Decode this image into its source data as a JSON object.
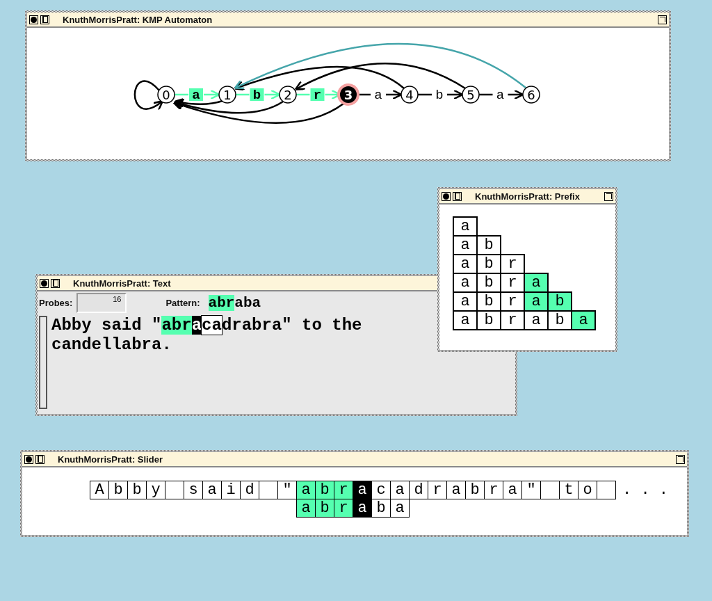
{
  "automaton_window": {
    "title": "KnuthMorrisPratt: KMP Automaton",
    "states": [
      {
        "label": "0",
        "kind": "plain"
      },
      {
        "label": "1",
        "kind": "plain"
      },
      {
        "label": "2",
        "kind": "plain"
      },
      {
        "label": "3",
        "kind": "current"
      },
      {
        "label": "4",
        "kind": "plain"
      },
      {
        "label": "5",
        "kind": "plain"
      },
      {
        "label": "6",
        "kind": "plain"
      }
    ],
    "failure_links": [
      {
        "highlighted": false
      },
      {
        "highlighted": false
      },
      {
        "highlighted": false
      },
      {
        "highlighted": false
      },
      {
        "highlighted": false
      },
      {
        "highlighted": true
      }
    ],
    "transitions": [
      {
        "label": "a",
        "highlighted": true
      },
      {
        "label": "b",
        "highlighted": true
      },
      {
        "label": "r",
        "highlighted": true
      },
      {
        "label": "a",
        "highlighted": false
      },
      {
        "label": "b",
        "highlighted": false
      },
      {
        "label": "a",
        "highlighted": false
      }
    ]
  },
  "text_window": {
    "title": "KnuthMorrisPratt: Text",
    "probes_label": "Probes:",
    "probes_value": "16",
    "pattern_label": "Pattern:",
    "pattern": [
      {
        "text": "abr",
        "kind": "match"
      },
      {
        "text": "aba",
        "kind": "plain"
      }
    ],
    "text": [
      {
        "text": "Abby said \"",
        "kind": "plain"
      },
      {
        "text": "abr",
        "kind": "match"
      },
      {
        "text": "a",
        "kind": "mismatch"
      },
      {
        "text": "ca",
        "kind": "window"
      },
      {
        "text": "drabra\" to the candellabra.",
        "kind": "plain"
      }
    ]
  },
  "prefix_window": {
    "title": "KnuthMorrisPratt: Prefix",
    "rows": [
      [
        {
          "char": "a",
          "highlighted": false
        }
      ],
      [
        {
          "char": "a",
          "highlighted": false
        },
        {
          "char": "b",
          "highlighted": false
        }
      ],
      [
        {
          "char": "a",
          "highlighted": false
        },
        {
          "char": "b",
          "highlighted": false
        },
        {
          "char": "r",
          "highlighted": false
        }
      ],
      [
        {
          "char": "a",
          "highlighted": false
        },
        {
          "char": "b",
          "highlighted": false
        },
        {
          "char": "r",
          "highlighted": false
        },
        {
          "char": "a",
          "highlighted": true
        }
      ],
      [
        {
          "char": "a",
          "highlighted": false
        },
        {
          "char": "b",
          "highlighted": false
        },
        {
          "char": "r",
          "highlighted": false
        },
        {
          "char": "a",
          "highlighted": true
        },
        {
          "char": "b",
          "highlighted": true
        }
      ],
      [
        {
          "char": "a",
          "highlighted": false
        },
        {
          "char": "b",
          "highlighted": false
        },
        {
          "char": "r",
          "highlighted": false
        },
        {
          "char": "a",
          "highlighted": false
        },
        {
          "char": "b",
          "highlighted": false
        },
        {
          "char": "a",
          "highlighted": true
        }
      ]
    ]
  },
  "slider_window": {
    "title": "KnuthMorrisPratt: Slider",
    "text_cells": [
      {
        "char": "A",
        "kind": "plain"
      },
      {
        "char": "b",
        "kind": "plain"
      },
      {
        "char": "b",
        "kind": "plain"
      },
      {
        "char": "y",
        "kind": "plain"
      },
      {
        "kind": "plain"
      },
      {
        "char": "s",
        "kind": "plain"
      },
      {
        "char": "a",
        "kind": "plain"
      },
      {
        "char": "i",
        "kind": "plain"
      },
      {
        "char": "d",
        "kind": "plain"
      },
      {
        "kind": "plain"
      },
      {
        "char": "\"",
        "kind": "plain"
      },
      {
        "char": "a",
        "kind": "match"
      },
      {
        "char": "b",
        "kind": "match"
      },
      {
        "char": "r",
        "kind": "match"
      },
      {
        "char": "a",
        "kind": "mismatch"
      },
      {
        "char": "c",
        "kind": "plain"
      },
      {
        "char": "a",
        "kind": "plain"
      },
      {
        "char": "d",
        "kind": "plain"
      },
      {
        "char": "r",
        "kind": "plain"
      },
      {
        "char": "a",
        "kind": "plain"
      },
      {
        "char": "b",
        "kind": "plain"
      },
      {
        "char": "r",
        "kind": "plain"
      },
      {
        "char": "a",
        "kind": "plain"
      },
      {
        "char": "\"",
        "kind": "plain"
      },
      {
        "kind": "plain"
      },
      {
        "char": "t",
        "kind": "plain"
      },
      {
        "char": "o",
        "kind": "plain"
      },
      {
        "kind": "plain"
      }
    ],
    "ellipsis": ". . .",
    "pattern_cells": [
      {
        "char": "a",
        "kind": "match"
      },
      {
        "char": "b",
        "kind": "match"
      },
      {
        "char": "r",
        "kind": "match"
      },
      {
        "char": "a",
        "kind": "mismatch"
      },
      {
        "char": "b",
        "kind": "plain"
      },
      {
        "char": "a",
        "kind": "plain"
      }
    ]
  }
}
